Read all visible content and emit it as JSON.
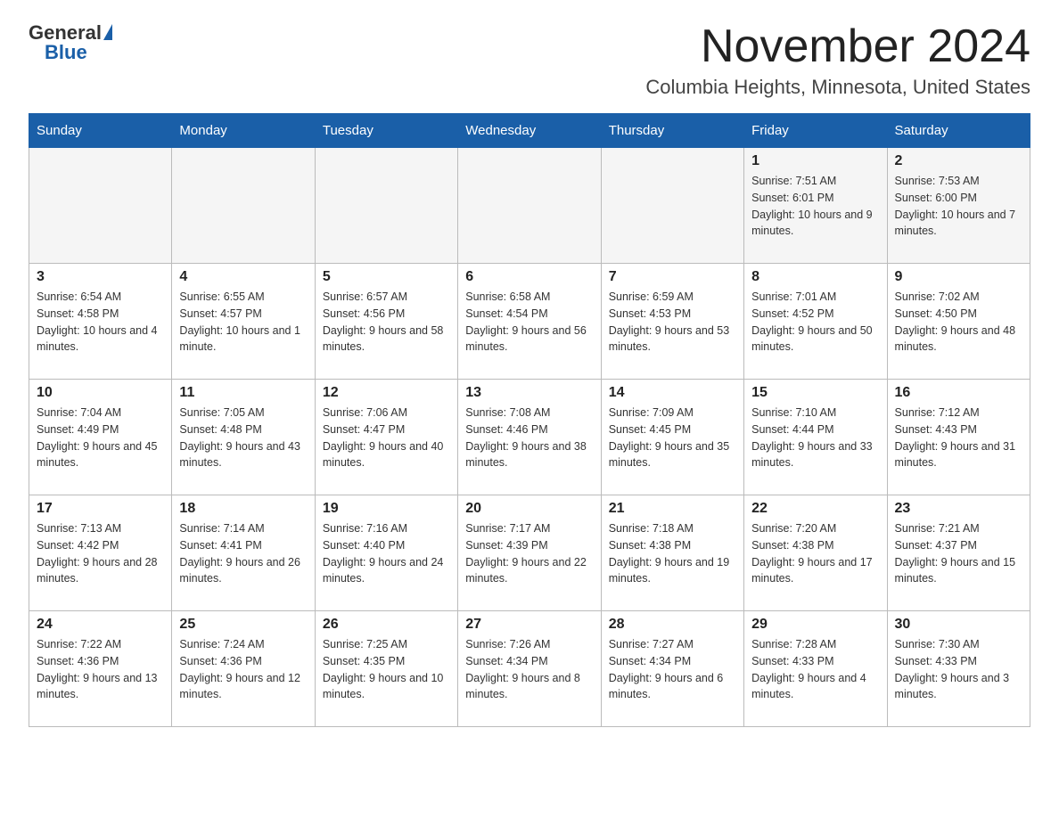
{
  "header": {
    "logo": {
      "general": "General",
      "blue": "Blue"
    },
    "title": "November 2024",
    "subtitle": "Columbia Heights, Minnesota, United States"
  },
  "weekdays": [
    "Sunday",
    "Monday",
    "Tuesday",
    "Wednesday",
    "Thursday",
    "Friday",
    "Saturday"
  ],
  "weeks": [
    {
      "days": [
        {
          "number": "",
          "sunrise": "",
          "sunset": "",
          "daylight": ""
        },
        {
          "number": "",
          "sunrise": "",
          "sunset": "",
          "daylight": ""
        },
        {
          "number": "",
          "sunrise": "",
          "sunset": "",
          "daylight": ""
        },
        {
          "number": "",
          "sunrise": "",
          "sunset": "",
          "daylight": ""
        },
        {
          "number": "",
          "sunrise": "",
          "sunset": "",
          "daylight": ""
        },
        {
          "number": "1",
          "sunrise": "Sunrise: 7:51 AM",
          "sunset": "Sunset: 6:01 PM",
          "daylight": "Daylight: 10 hours and 9 minutes."
        },
        {
          "number": "2",
          "sunrise": "Sunrise: 7:53 AM",
          "sunset": "Sunset: 6:00 PM",
          "daylight": "Daylight: 10 hours and 7 minutes."
        }
      ]
    },
    {
      "days": [
        {
          "number": "3",
          "sunrise": "Sunrise: 6:54 AM",
          "sunset": "Sunset: 4:58 PM",
          "daylight": "Daylight: 10 hours and 4 minutes."
        },
        {
          "number": "4",
          "sunrise": "Sunrise: 6:55 AM",
          "sunset": "Sunset: 4:57 PM",
          "daylight": "Daylight: 10 hours and 1 minute."
        },
        {
          "number": "5",
          "sunrise": "Sunrise: 6:57 AM",
          "sunset": "Sunset: 4:56 PM",
          "daylight": "Daylight: 9 hours and 58 minutes."
        },
        {
          "number": "6",
          "sunrise": "Sunrise: 6:58 AM",
          "sunset": "Sunset: 4:54 PM",
          "daylight": "Daylight: 9 hours and 56 minutes."
        },
        {
          "number": "7",
          "sunrise": "Sunrise: 6:59 AM",
          "sunset": "Sunset: 4:53 PM",
          "daylight": "Daylight: 9 hours and 53 minutes."
        },
        {
          "number": "8",
          "sunrise": "Sunrise: 7:01 AM",
          "sunset": "Sunset: 4:52 PM",
          "daylight": "Daylight: 9 hours and 50 minutes."
        },
        {
          "number": "9",
          "sunrise": "Sunrise: 7:02 AM",
          "sunset": "Sunset: 4:50 PM",
          "daylight": "Daylight: 9 hours and 48 minutes."
        }
      ]
    },
    {
      "days": [
        {
          "number": "10",
          "sunrise": "Sunrise: 7:04 AM",
          "sunset": "Sunset: 4:49 PM",
          "daylight": "Daylight: 9 hours and 45 minutes."
        },
        {
          "number": "11",
          "sunrise": "Sunrise: 7:05 AM",
          "sunset": "Sunset: 4:48 PM",
          "daylight": "Daylight: 9 hours and 43 minutes."
        },
        {
          "number": "12",
          "sunrise": "Sunrise: 7:06 AM",
          "sunset": "Sunset: 4:47 PM",
          "daylight": "Daylight: 9 hours and 40 minutes."
        },
        {
          "number": "13",
          "sunrise": "Sunrise: 7:08 AM",
          "sunset": "Sunset: 4:46 PM",
          "daylight": "Daylight: 9 hours and 38 minutes."
        },
        {
          "number": "14",
          "sunrise": "Sunrise: 7:09 AM",
          "sunset": "Sunset: 4:45 PM",
          "daylight": "Daylight: 9 hours and 35 minutes."
        },
        {
          "number": "15",
          "sunrise": "Sunrise: 7:10 AM",
          "sunset": "Sunset: 4:44 PM",
          "daylight": "Daylight: 9 hours and 33 minutes."
        },
        {
          "number": "16",
          "sunrise": "Sunrise: 7:12 AM",
          "sunset": "Sunset: 4:43 PM",
          "daylight": "Daylight: 9 hours and 31 minutes."
        }
      ]
    },
    {
      "days": [
        {
          "number": "17",
          "sunrise": "Sunrise: 7:13 AM",
          "sunset": "Sunset: 4:42 PM",
          "daylight": "Daylight: 9 hours and 28 minutes."
        },
        {
          "number": "18",
          "sunrise": "Sunrise: 7:14 AM",
          "sunset": "Sunset: 4:41 PM",
          "daylight": "Daylight: 9 hours and 26 minutes."
        },
        {
          "number": "19",
          "sunrise": "Sunrise: 7:16 AM",
          "sunset": "Sunset: 4:40 PM",
          "daylight": "Daylight: 9 hours and 24 minutes."
        },
        {
          "number": "20",
          "sunrise": "Sunrise: 7:17 AM",
          "sunset": "Sunset: 4:39 PM",
          "daylight": "Daylight: 9 hours and 22 minutes."
        },
        {
          "number": "21",
          "sunrise": "Sunrise: 7:18 AM",
          "sunset": "Sunset: 4:38 PM",
          "daylight": "Daylight: 9 hours and 19 minutes."
        },
        {
          "number": "22",
          "sunrise": "Sunrise: 7:20 AM",
          "sunset": "Sunset: 4:38 PM",
          "daylight": "Daylight: 9 hours and 17 minutes."
        },
        {
          "number": "23",
          "sunrise": "Sunrise: 7:21 AM",
          "sunset": "Sunset: 4:37 PM",
          "daylight": "Daylight: 9 hours and 15 minutes."
        }
      ]
    },
    {
      "days": [
        {
          "number": "24",
          "sunrise": "Sunrise: 7:22 AM",
          "sunset": "Sunset: 4:36 PM",
          "daylight": "Daylight: 9 hours and 13 minutes."
        },
        {
          "number": "25",
          "sunrise": "Sunrise: 7:24 AM",
          "sunset": "Sunset: 4:36 PM",
          "daylight": "Daylight: 9 hours and 12 minutes."
        },
        {
          "number": "26",
          "sunrise": "Sunrise: 7:25 AM",
          "sunset": "Sunset: 4:35 PM",
          "daylight": "Daylight: 9 hours and 10 minutes."
        },
        {
          "number": "27",
          "sunrise": "Sunrise: 7:26 AM",
          "sunset": "Sunset: 4:34 PM",
          "daylight": "Daylight: 9 hours and 8 minutes."
        },
        {
          "number": "28",
          "sunrise": "Sunrise: 7:27 AM",
          "sunset": "Sunset: 4:34 PM",
          "daylight": "Daylight: 9 hours and 6 minutes."
        },
        {
          "number": "29",
          "sunrise": "Sunrise: 7:28 AM",
          "sunset": "Sunset: 4:33 PM",
          "daylight": "Daylight: 9 hours and 4 minutes."
        },
        {
          "number": "30",
          "sunrise": "Sunrise: 7:30 AM",
          "sunset": "Sunset: 4:33 PM",
          "daylight": "Daylight: 9 hours and 3 minutes."
        }
      ]
    }
  ]
}
